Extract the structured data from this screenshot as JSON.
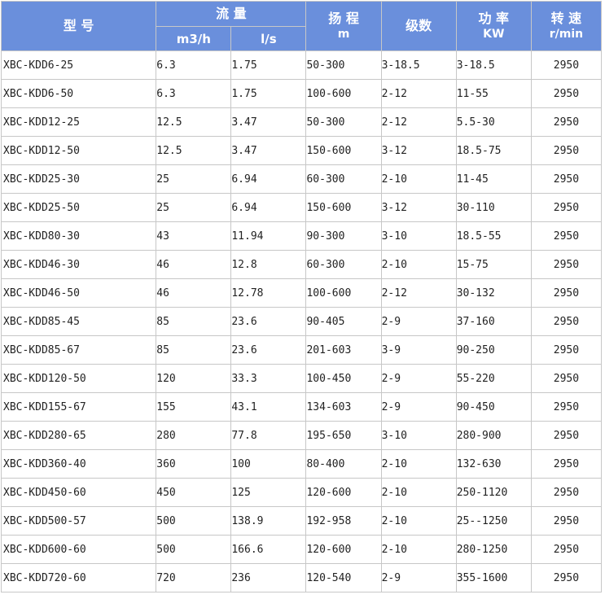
{
  "header": {
    "model": "型 号",
    "flow": "流 量",
    "flow_m3h": "m3/h",
    "flow_ls": "l/s",
    "head": "扬 程",
    "head_unit": "m",
    "stages": "级数",
    "power": "功 率",
    "power_unit": "KW",
    "speed": "转 速",
    "speed_unit": "r/min"
  },
  "rows": [
    {
      "model": "XBC-KDD6-25",
      "m3h": "6.3",
      "ls": "1.75",
      "head": "50-300",
      "stages": "3-18.5",
      "power": "3-18.5",
      "speed": "2950"
    },
    {
      "model": "XBC-KDD6-50",
      "m3h": "6.3",
      "ls": "1.75",
      "head": "100-600",
      "stages": "2-12",
      "power": "11-55",
      "speed": "2950"
    },
    {
      "model": "XBC-KDD12-25",
      "m3h": "12.5",
      "ls": "3.47",
      "head": "50-300",
      "stages": "2-12",
      "power": "5.5-30",
      "speed": "2950"
    },
    {
      "model": "XBC-KDD12-50",
      "m3h": "12.5",
      "ls": "3.47",
      "head": "150-600",
      "stages": "3-12",
      "power": "18.5-75",
      "speed": "2950"
    },
    {
      "model": "XBC-KDD25-30",
      "m3h": "25",
      "ls": "6.94",
      "head": "60-300",
      "stages": "2-10",
      "power": "11-45",
      "speed": "2950"
    },
    {
      "model": "XBC-KDD25-50",
      "m3h": "25",
      "ls": "6.94",
      "head": "150-600",
      "stages": "3-12",
      "power": "30-110",
      "speed": "2950"
    },
    {
      "model": "XBC-KDD80-30",
      "m3h": "43",
      "ls": "11.94",
      "head": "90-300",
      "stages": "3-10",
      "power": "18.5-55",
      "speed": "2950"
    },
    {
      "model": "XBC-KDD46-30",
      "m3h": "46",
      "ls": "12.8",
      "head": "60-300",
      "stages": "2-10",
      "power": "15-75",
      "speed": "2950"
    },
    {
      "model": "XBC-KDD46-50",
      "m3h": "46",
      "ls": "12.78",
      "head": "100-600",
      "stages": "2-12",
      "power": "30-132",
      "speed": "2950"
    },
    {
      "model": "XBC-KDD85-45",
      "m3h": "85",
      "ls": "23.6",
      "head": "90-405",
      "stages": "2-9",
      "power": "37-160",
      "speed": "2950"
    },
    {
      "model": "XBC-KDD85-67",
      "m3h": "85",
      "ls": "23.6",
      "head": "201-603",
      "stages": "3-9",
      "power": "90-250",
      "speed": "2950"
    },
    {
      "model": "XBC-KDD120-50",
      "m3h": "120",
      "ls": "33.3",
      "head": "100-450",
      "stages": "2-9",
      "power": "55-220",
      "speed": "2950"
    },
    {
      "model": "XBC-KDD155-67",
      "m3h": "155",
      "ls": "43.1",
      "head": "134-603",
      "stages": "2-9",
      "power": "90-450",
      "speed": "2950"
    },
    {
      "model": "XBC-KDD280-65",
      "m3h": "280",
      "ls": "77.8",
      "head": "195-650",
      "stages": "3-10",
      "power": "280-900",
      "speed": "2950"
    },
    {
      "model": "XBC-KDD360-40",
      "m3h": "360",
      "ls": "100",
      "head": "80-400",
      "stages": "2-10",
      "power": "132-630",
      "speed": "2950"
    },
    {
      "model": "XBC-KDD450-60",
      "m3h": "450",
      "ls": "125",
      "head": "120-600",
      "stages": "2-10",
      "power": "250-1120",
      "speed": "2950"
    },
    {
      "model": "XBC-KDD500-57",
      "m3h": "500",
      "ls": "138.9",
      "head": "192-958",
      "stages": "2-10",
      "power": "25--1250",
      "speed": "2950"
    },
    {
      "model": "XBC-KDD600-60",
      "m3h": "500",
      "ls": "166.6",
      "head": "120-600",
      "stages": "2-10",
      "power": "280-1250",
      "speed": "2950"
    },
    {
      "model": "XBC-KDD720-60",
      "m3h": "720",
      "ls": "236",
      "head": "120-540",
      "stages": "2-9",
      "power": "355-1600",
      "speed": "2950"
    }
  ]
}
